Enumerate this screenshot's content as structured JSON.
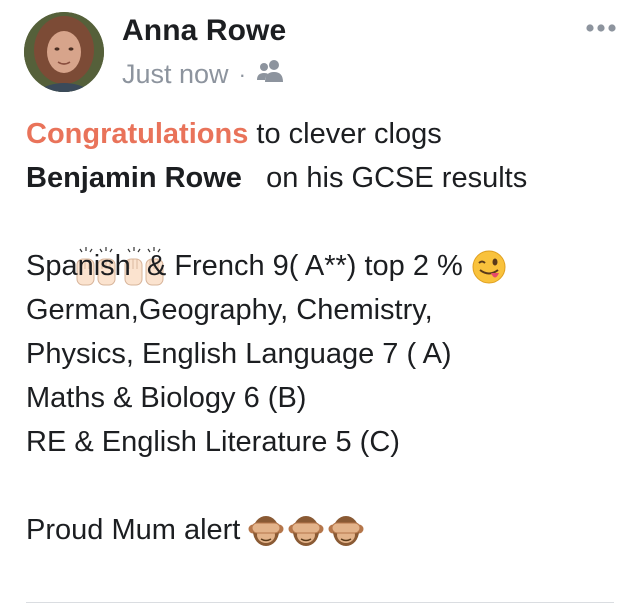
{
  "post": {
    "author": "Anna Rowe",
    "timestamp": "Just now",
    "separator": "·",
    "audience_icon": "friends-icon",
    "more_icon": "more-options-icon",
    "lines": {
      "l1_highlight": "Congratulations",
      "l1_rest": " to clever clogs",
      "l2_tag": "Benjamin Rowe",
      "l2_rest": "   on his GCSE results",
      "l3_emoji": "raising-hands-emoji",
      "l4_text": "Spanish  & French 9( A**) top 2 % ",
      "l4_emoji": "winking-face-with-tongue-emoji",
      "l5_text": "German,Geography, Chemistry,",
      "l6_text": "Physics, English Language 7 ( A)",
      "l7_text": "Maths & Biology 6 (B)",
      "l8_text": "RE & English Literature 5 (C)",
      "l10_text": "Proud Mum alert ",
      "l10_emoji": "see-no-evil-monkey-emoji"
    }
  },
  "colors": {
    "highlight": "#e9735a",
    "meta": "#8d949e",
    "text": "#1c1e21"
  }
}
